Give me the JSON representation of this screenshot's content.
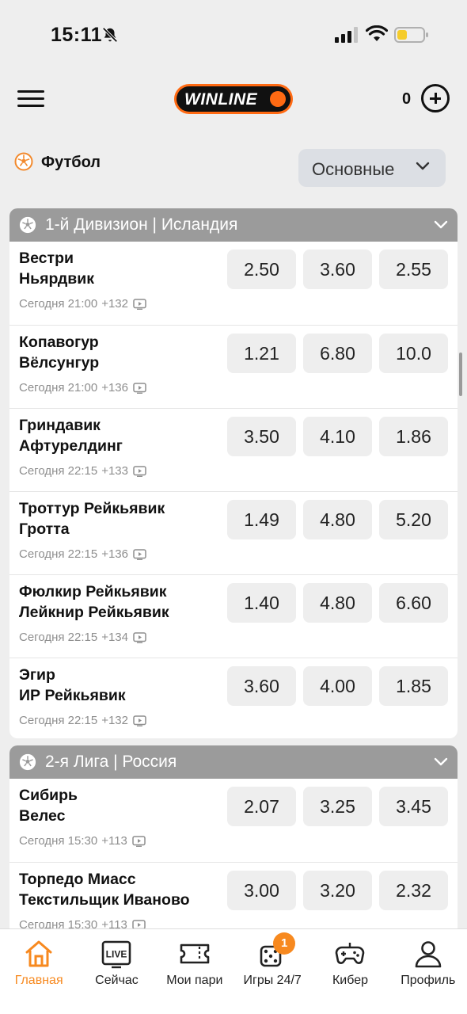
{
  "status": {
    "time": "15:11"
  },
  "header": {
    "logo_text": "WINLINE",
    "balance": "0"
  },
  "sport": {
    "label": "Футбол",
    "filter": "Основные"
  },
  "leagues": [
    {
      "title": "1-й Дивизион | Исландия",
      "matches": [
        {
          "team1": "Вестри",
          "team2": "Ньярдвик",
          "time": "Сегодня 21:00",
          "extra": "+132",
          "odds": [
            "2.50",
            "3.60",
            "2.55"
          ]
        },
        {
          "team1": "Копавогур",
          "team2": "Вёлсунгур",
          "time": "Сегодня 21:00",
          "extra": "+136",
          "odds": [
            "1.21",
            "6.80",
            "10.0"
          ]
        },
        {
          "team1": "Гриндавик",
          "team2": "Афтурелдинг",
          "time": "Сегодня 22:15",
          "extra": "+133",
          "odds": [
            "3.50",
            "4.10",
            "1.86"
          ]
        },
        {
          "team1": "Троттур Рейкьявик",
          "team2": "Гротта",
          "time": "Сегодня 22:15",
          "extra": "+136",
          "odds": [
            "1.49",
            "4.80",
            "5.20"
          ]
        },
        {
          "team1": "Фюлкир Рейкьявик",
          "team2": "Лейкнир Рейкьявик",
          "time": "Сегодня 22:15",
          "extra": "+134",
          "odds": [
            "1.40",
            "4.80",
            "6.60"
          ]
        },
        {
          "team1": "Эгир",
          "team2": "ИР Рейкьявик",
          "time": "Сегодня 22:15",
          "extra": "+132",
          "odds": [
            "3.60",
            "4.00",
            "1.85"
          ]
        }
      ]
    },
    {
      "title": "2-я Лига | Россия",
      "matches": [
        {
          "team1": "Сибирь",
          "team2": "Велес",
          "time": "Сегодня 15:30",
          "extra": "+113",
          "odds": [
            "2.07",
            "3.25",
            "3.45"
          ]
        },
        {
          "team1": "Торпедо Миасс",
          "team2": "Текстильщик Иваново",
          "time": "Сегодня 15:30",
          "extra": "+113",
          "odds": [
            "3.00",
            "3.20",
            "2.32"
          ]
        }
      ]
    }
  ],
  "nav": {
    "home": "Главная",
    "live": "Сейчас",
    "live_icon_text": "LIVE",
    "bets": "Мои пари",
    "games": "Игры 24/7",
    "games_badge": "1",
    "cyber": "Кибер",
    "profile": "Профиль"
  },
  "colors": {
    "accent": "#f7891f",
    "league_header": "#9b9b9b",
    "odd_bg": "#eeeeee"
  },
  "icons": [
    "bell-off-icon",
    "signal-icon",
    "wifi-icon",
    "battery-icon",
    "menu-icon",
    "plus-circle-icon",
    "soccer-ball-icon",
    "chevron-down-icon",
    "tv-icon",
    "home-icon",
    "live-icon",
    "ticket-icon",
    "dice-icon",
    "gamepad-icon",
    "profile-icon"
  ]
}
